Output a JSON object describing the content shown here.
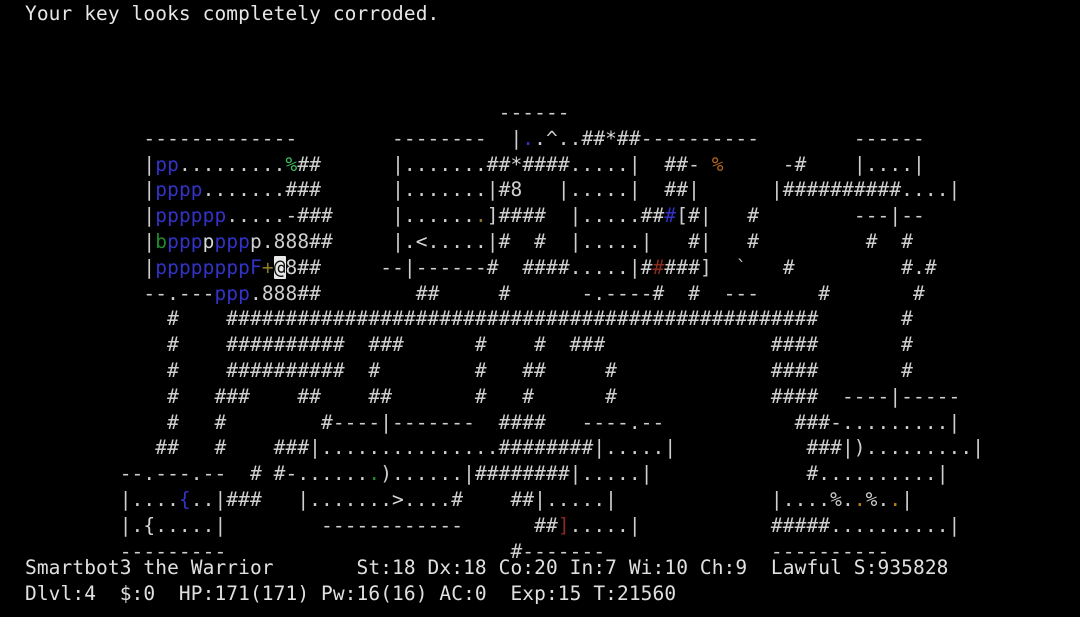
{
  "window": {
    "app": "NetHack",
    "background_color": "#000000",
    "foreground_color": "#d8d8d8"
  },
  "message": {
    "text": "Your key looks completely corroded."
  },
  "colors": {
    "white": "#d8d8d8",
    "gray": "#b4b4b4",
    "blue": "#3333c8",
    "green": "#1f8a2f",
    "light_green": "#3fbf5f",
    "yellow": "#b8860b",
    "orange": "#b5651d",
    "red": "#8b2b20",
    "cursor_highlight": "#e8e8e8"
  },
  "map": {
    "rows": [
      "                                        ------                                  ",
      "          -------------        --------  |..^..##*##----------        ------    ",
      "          |pp.........%##      |.......##*####.....|  ##- %     -#    |....|    ",
      "          |pppp.......###      |.......|#8   |.....|  ##|      |##########....| ",
      "          |pppppp.....-###     |.......]####  |.....###[#|   #        ---|--    ",
      "          |bpppppppp.888##     |.<.....|#  #  |.....|   #|   #         #  #     ",
      "          |ppppppppF+@8##     --|------#  ####.....|#####]  `   #         #.#   ",
      "          --.---ppp.888##        ##     #      -.----#  #  ---     #       #    ",
      "            #    ##################################################       #     ",
      "            #    ##########  ###      #    #  ###              ####       #     ",
      "            #    ##########  #        #   ##     #             ####       #     ",
      "            #   ###    ##    ##       #   #      #             ####  ----|----- ",
      "            #   #        #----|-------  ####   ----.--           ###-.........| ",
      "           ##   #    ###|...............########|.....|           ###|).........|",
      "        --.---.--  # #-.......)......|########|.....|             #..........|  ",
      "        |....{..|###   |.......>....#    ##|.....|             |....%..%..|     ",
      "        |.{.....|        ------------      ##].....|           #####..........| ",
      "        ---------                        #-------              ----------       "
    ]
  },
  "status": {
    "line1": {
      "character_name": "Smartbot3",
      "title": "the Warrior",
      "strength": "St:18",
      "dexterity": "Dx:18",
      "constitution": "Co:20",
      "intelligence": "In:7",
      "wisdom": "Wi:10",
      "charisma": "Ch:9",
      "alignment": "Lawful",
      "score": "S:935828",
      "full": "Smartbot3 the Warrior       St:18 Dx:18 Co:20 In:7 Wi:10 Ch:9  Lawful S:935828"
    },
    "line2": {
      "dungeon_level": "Dlvl:4",
      "gold": "$:0",
      "hit_points": "HP:171(171)",
      "power": "Pw:16(16)",
      "armor_class": "AC:0",
      "experience": "Exp:15",
      "turns": "T:21560",
      "full": "Dlvl:4  $:0  HP:171(171) Pw:16(16) AC:0  Exp:15 T:21560"
    }
  },
  "glyphs": {
    "player": "@",
    "player_description": "hero",
    "downstairs": ">",
    "upstairs": "<",
    "fountain": "{",
    "boulder": "8",
    "corridor": "#",
    "floor": ".",
    "wall_horizontal": "-",
    "wall_vertical": "|",
    "door_open": "|",
    "trap": "^",
    "weapon": ")",
    "armor": "]",
    "food": "%",
    "gem": "*",
    "spellbook": "+",
    "monster_p": "p",
    "monster_b": "b",
    "monster_F": "F",
    "boulder_rock": "`"
  }
}
